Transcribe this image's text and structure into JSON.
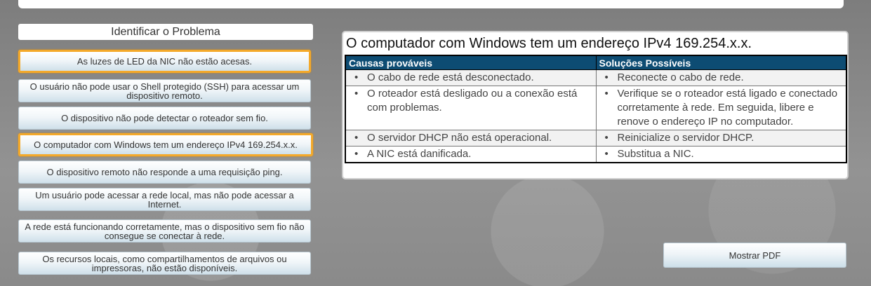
{
  "side_title": "Identificar o Problema",
  "problems": [
    {
      "label": "As luzes de LED da NIC não estão acesas.",
      "selected": true
    },
    {
      "label": "O usuário não pode usar o Shell protegido (SSH) para acessar um dispositivo remoto.",
      "selected": false
    },
    {
      "label": "O dispositivo não pode detectar o roteador sem fio.",
      "selected": false
    },
    {
      "label": "O computador com Windows tem um endereço IPv4 169.254.x.x.",
      "selected": true
    },
    {
      "label": "O dispositivo remoto não responde a uma requisição ping.",
      "selected": false
    },
    {
      "label": "Um usuário pode acessar a rede local, mas não pode acessar a Internet.",
      "selected": false
    },
    {
      "label": "A rede está funcionando corretamente, mas o dispositivo sem fio não consegue se conectar à rede.",
      "selected": false
    },
    {
      "label": "Os recursos locais, como compartilhamentos de arquivos ou impressoras, não estão disponíveis.",
      "selected": false
    }
  ],
  "detail": {
    "title": "O computador com Windows tem um endereço IPv4 169.254.x.x.",
    "headers": {
      "causes": "Causas prováveis",
      "solutions": "Soluções Possíveis"
    },
    "bullet": "•",
    "rows": [
      {
        "cause": "O cabo de rede está desconectado.",
        "solution": "Reconecte o cabo de rede."
      },
      {
        "cause": "O roteador está desligado ou a conexão está com problemas.",
        "solution": "Verifique se o roteador está ligado e conectado corretamente à rede. Em seguida, libere e renove o endereço IP no computador."
      },
      {
        "cause": "O servidor DHCP não está operacional.",
        "solution": "Reinicialize o servidor DHCP."
      },
      {
        "cause": "A NIC está danificada.",
        "solution": "Substitua a NIC."
      }
    ]
  },
  "pdf_button": "Mostrar PDF"
}
